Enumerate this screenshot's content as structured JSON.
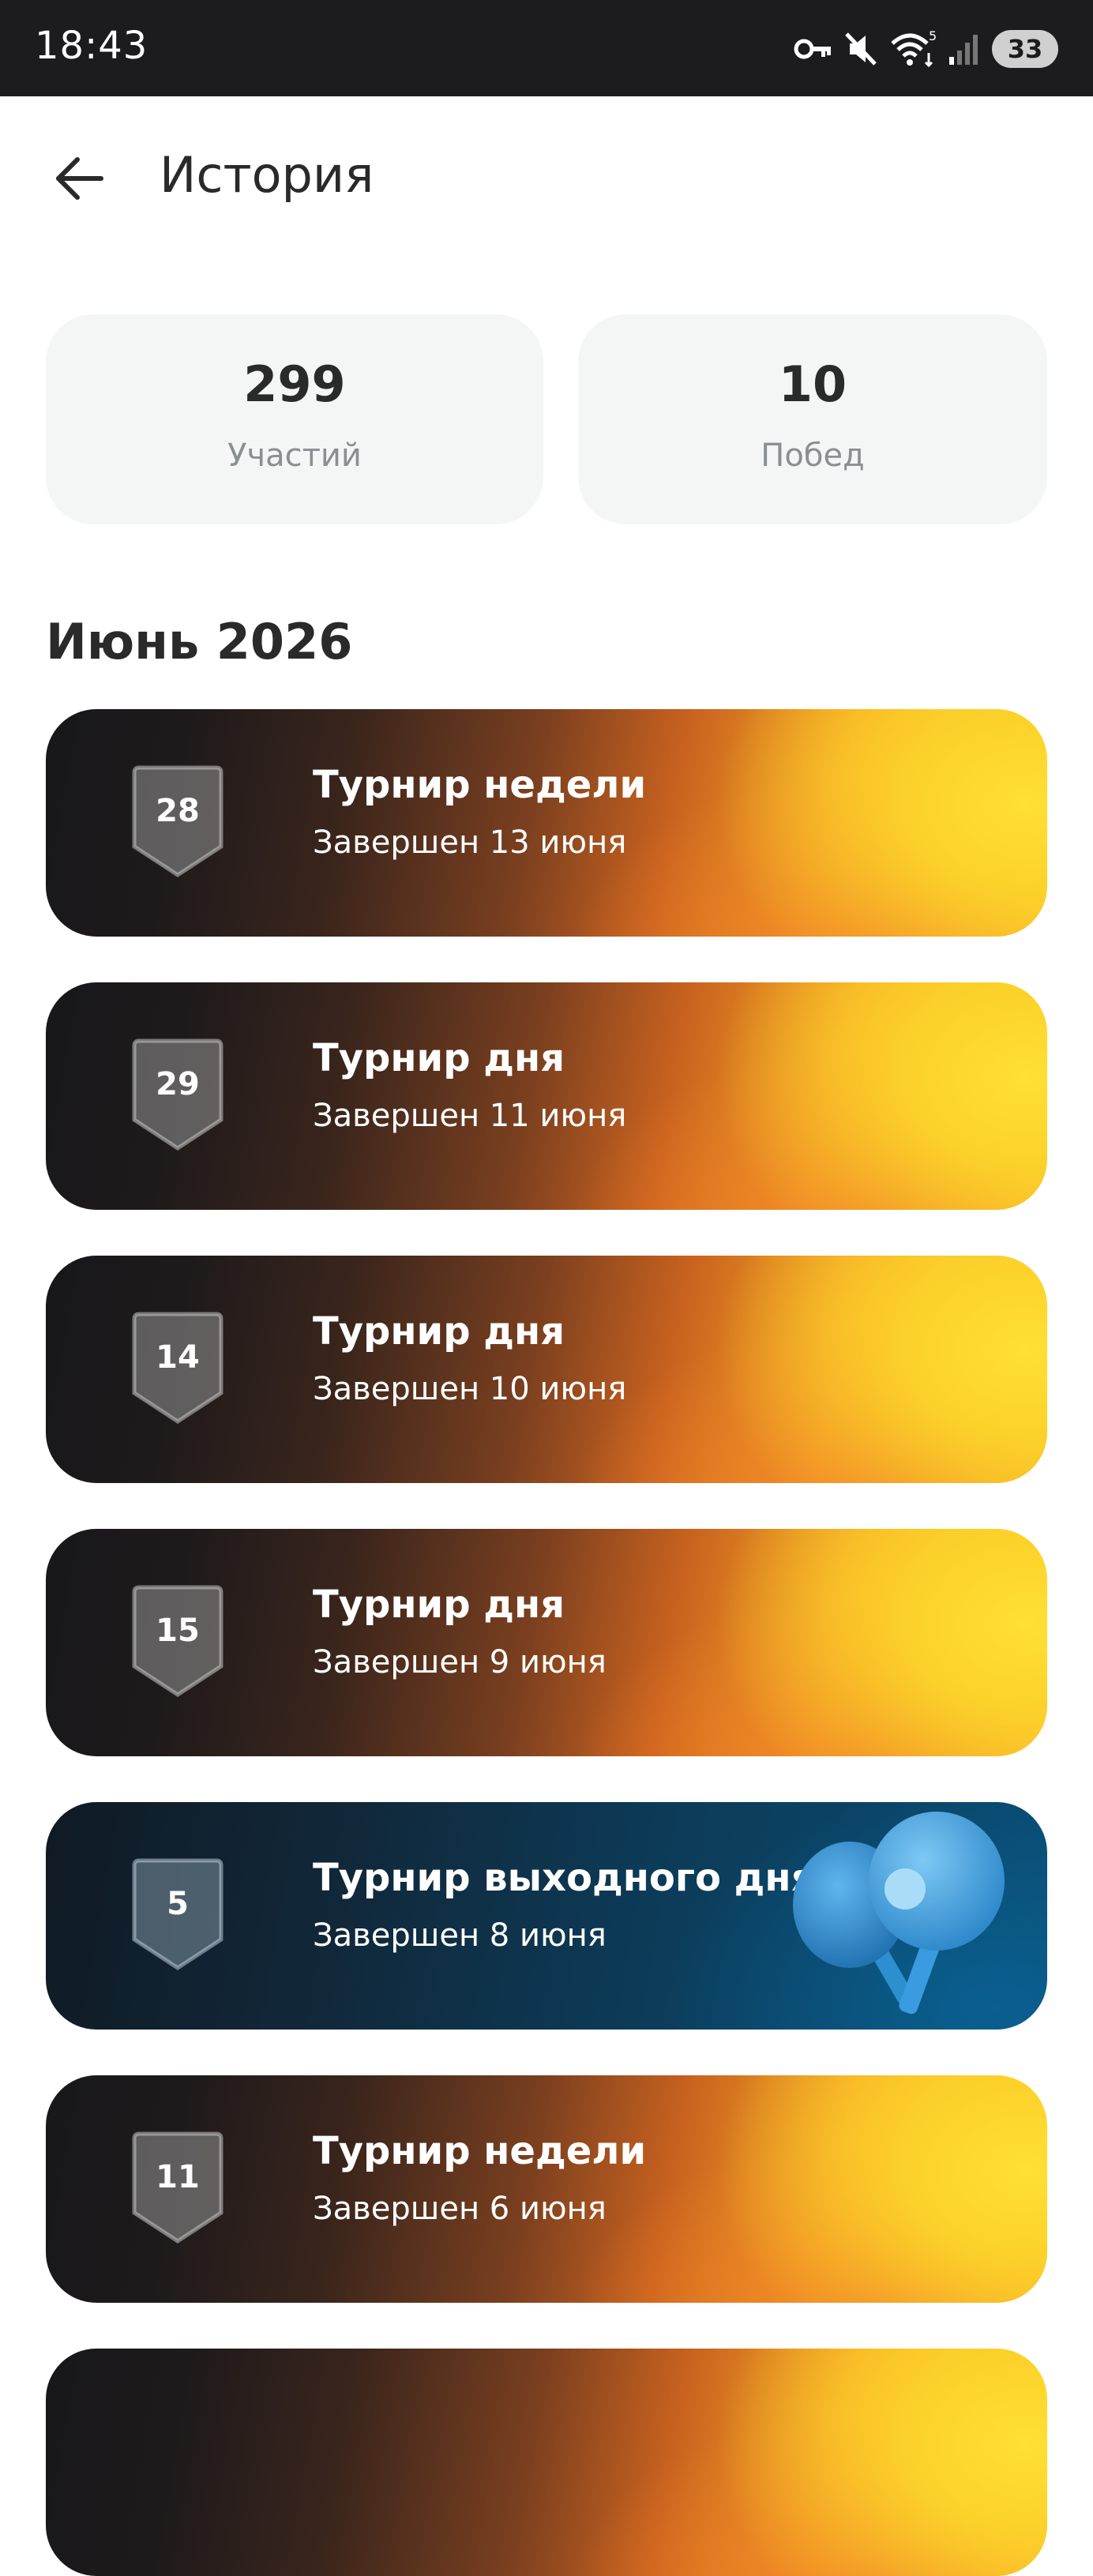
{
  "status_bar": {
    "time": "18:43",
    "icons": [
      "key-icon",
      "mute-icon",
      "wifi-icon",
      "signal-icon"
    ],
    "wifi_sub": "5",
    "battery": "33"
  },
  "header": {
    "title": "История",
    "back_icon": "arrow-left-icon"
  },
  "stats": [
    {
      "value": "299",
      "label": "Участий"
    },
    {
      "value": "10",
      "label": "Побед"
    }
  ],
  "section": {
    "title": "Июнь 2026"
  },
  "tournaments": [
    {
      "place": "28",
      "title": "Турнир недели",
      "status": "Завершен 13 июня",
      "theme": "orange"
    },
    {
      "place": "29",
      "title": "Турнир дня",
      "status": "Завершен 11 июня",
      "theme": "orange"
    },
    {
      "place": "14",
      "title": "Турнир дня",
      "status": "Завершен 10 июня",
      "theme": "orange"
    },
    {
      "place": "15",
      "title": "Турнир дня",
      "status": "Завершен 9 июня",
      "theme": "orange"
    },
    {
      "place": "5",
      "title": "Турнир выходного дня",
      "status": "Завершен 8 июня",
      "theme": "blue",
      "illustration": "ping-pong-paddles-icon"
    },
    {
      "place": "11",
      "title": "Турнир недели",
      "status": "Завершен 6 июня",
      "theme": "orange"
    }
  ],
  "colors": {
    "accent_yellow": "#ffd42a",
    "accent_orange": "#ef7d26",
    "card_dark": "#17171a",
    "card_blue": "#0a4d74",
    "stat_bg": "#f4f6f6"
  }
}
